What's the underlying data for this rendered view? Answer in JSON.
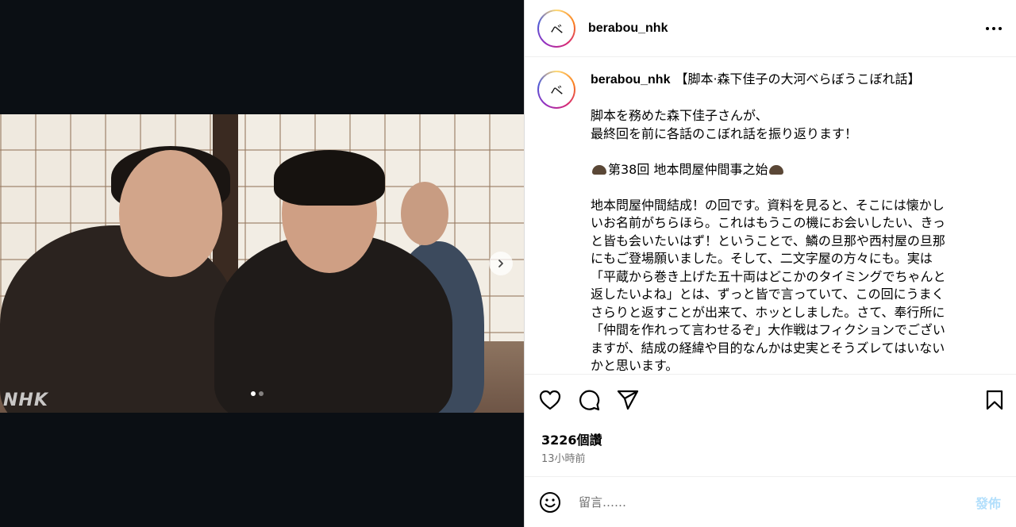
{
  "post": {
    "username": "berabou_nhk",
    "media": {
      "watermark": "NHK",
      "carousel_total": 2,
      "carousel_current": 1
    },
    "caption": {
      "title": "【脚本·森下佳子の大河べらぼうこぼれ話】",
      "lines": [
        "脚本を務めた森下佳子さんが、",
        "最終回を前に各話のこぼれ話を振り返ります！"
      ],
      "episode": "第38回 地本問屋仲間事之始",
      "body": [
        "地本問屋仲間結成！の回です。資料を見ると、そこには懐かし",
        "いお名前がちらほら。これはもうこの機にお会いしたい、きっ",
        "と皆も会いたいはず！ということで、鱗の旦那や西村屋の旦那",
        "にもご登場願いました。そして、二文字屋の方々にも。実は",
        "「平蔵から巻き上げた五十両はどこかのタイミングでちゃんと",
        "返したいよね」とは、ずっと皆で言っていて、この回にうまく",
        "さらりと返すことが出来て、ホッとしました。さて、奉行所に",
        "「仲間を作れって言わせるぞ」大作戦はフィクションでござい",
        "ますが、結成の経緯や目的なんかは史実とそうズレてはいない",
        "かと思います。"
      ]
    },
    "likes": "3226個讚",
    "time_ago": "13小時前"
  },
  "comment": {
    "placeholder": "留言……",
    "post_label": "發佈",
    "post_color": "#b2dffc"
  },
  "icons": {
    "heart": "heart-icon",
    "comment": "comment-icon",
    "share": "share-icon",
    "save": "bookmark-icon",
    "more": "more-icon",
    "emoji": "emoji-icon",
    "next": "chevron-right-icon"
  },
  "colors": {
    "story_ring": [
      "#feda75",
      "#fa7e1e",
      "#d62976",
      "#962fbf",
      "#4f5bd5"
    ],
    "media_bg": "#0b0f14",
    "muted_text": "#737373"
  }
}
